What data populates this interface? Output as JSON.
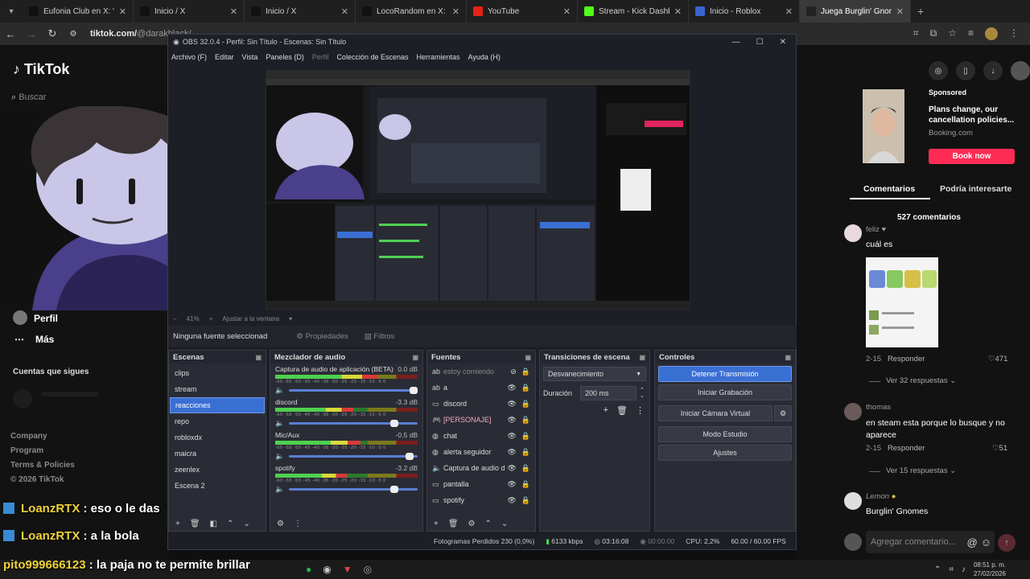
{
  "browser": {
    "tabs": [
      {
        "title": "Eufonia Club en X: \"MÁR",
        "icon": "x-icon",
        "color": "#111"
      },
      {
        "title": "Inicio / X",
        "icon": "x-icon",
        "color": "#111"
      },
      {
        "title": "Inicio / X",
        "icon": "x-icon",
        "color": "#111"
      },
      {
        "title": "LocoRandom en X: \"RESI",
        "icon": "x-icon",
        "color": "#111"
      },
      {
        "title": "YouTube",
        "icon": "youtube-icon",
        "color": "#e62117"
      },
      {
        "title": "Stream - Kick Dashboard",
        "icon": "kick-icon",
        "color": "#53fc18"
      },
      {
        "title": "Inicio - Roblox",
        "icon": "roblox-icon",
        "color": "#3b63d1"
      },
      {
        "title": "Juega Burglin' Gnomes: L",
        "icon": "tiktok-icon",
        "color": "#222"
      }
    ],
    "url_host": "tiktok.com/",
    "url_path": "@darakblack/..."
  },
  "tiktok": {
    "logo": "TikTok",
    "search": "Buscar",
    "profile": "Perfil",
    "more": "Más",
    "following": "Cuentas que sigues",
    "footer": [
      "Company",
      "Program",
      "Terms & Policies",
      "© 2026 TikTok"
    ],
    "sponsored": "Sponsored",
    "ad_title": "Plans change, our cancellation policies...",
    "ad_source": "Booking.com",
    "book_now": "Book now",
    "tab_comments": "Comentarios",
    "tab_interest": "Podría interesarte",
    "comments_count": "527 comentarios",
    "comments": [
      {
        "user": "feliz",
        "text": "cuál es",
        "date": "2-15",
        "reply": "Responder",
        "likes": "471",
        "replies": "Ver 32 respuestas"
      },
      {
        "user": "thomas",
        "text": "en steam esta porque lo busque y no aparece",
        "date": "2-15",
        "reply": "Responder",
        "likes": "51",
        "replies": "Ver 15 respuestas"
      },
      {
        "user": "Lemon",
        "text": "Burglin' Gnomes"
      }
    ],
    "add_comment": "Agregar comentario..."
  },
  "obs": {
    "title": "OBS 32.0.4 - Perfil: Sin Título - Escenas: Sin Título",
    "menu": [
      "Archivo (F)",
      "Editar",
      "Vista",
      "Paneles (D)",
      "Perfil",
      "Colección de Escenas",
      "Herramientas",
      "Ayuda (H)"
    ],
    "zoom": "41%",
    "fit": "Ajustar a la ventana",
    "no_source": "Ninguna fuente seleccionad",
    "properties": "Propiedades",
    "filters": "Filtros",
    "scenes_title": "Escenas",
    "scenes": [
      "clips",
      "stream",
      "reacciones",
      "repo",
      "robloxdx",
      "maicra",
      "zeenlex",
      "Escena 2"
    ],
    "mixer_title": "Mezclador de audio",
    "mixer": [
      {
        "name": "Captura de audio de aplicación (BETA)",
        "db": "0.0 dB",
        "level": 0.72,
        "vol": 1.0
      },
      {
        "name": "discord",
        "db": "-3.3 dB",
        "level": 0.55,
        "vol": 0.85
      },
      {
        "name": "Mic/Aux",
        "db": "-0.5 dB",
        "level": 0.6,
        "vol": 0.97
      },
      {
        "name": "spotify",
        "db": "-3.2 dB",
        "level": 0.5,
        "vol": 0.85
      }
    ],
    "scale": "-60 -55 -50 -45 -40 -35 -30 -25 -20 -15 -10 -5 0",
    "sources_title": "Fuentes",
    "sources": [
      {
        "name": "estoy comiendo",
        "icon": "text-icon",
        "dim": true
      },
      {
        "name": "a",
        "icon": "text-icon",
        "dim": false
      },
      {
        "name": "discord",
        "icon": "window-icon",
        "dim": false
      },
      {
        "name": "[PERSONAJE]",
        "icon": "game-icon",
        "dim": false
      },
      {
        "name": "chat",
        "icon": "globe-icon",
        "dim": false
      },
      {
        "name": "alerta seguidor",
        "icon": "globe-icon",
        "dim": false
      },
      {
        "name": "Captura de audio d",
        "icon": "speaker-icon",
        "dim": false
      },
      {
        "name": "pantalla",
        "icon": "monitor-icon",
        "dim": false
      },
      {
        "name": "spotify",
        "icon": "window-icon",
        "dim": false
      }
    ],
    "transitions_title": "Transiciones de escena",
    "transition": "Desvanecimiento",
    "duration_label": "Duración",
    "duration": "200 ms",
    "controls_title": "Controles",
    "controls": [
      "Detener Transmisión",
      "Iniciar Grabación",
      "Iniciar Cámara Virtual",
      "Modo Estudio",
      "Ajustes"
    ],
    "status": {
      "dropped": "Fotogramas Perdidos 230 (0,0%)",
      "kbps": "6133 kbps",
      "time": "03:16:08",
      "rec": "00:00:00",
      "cpu": "CPU: 2,2%",
      "fps": "60.00 / 60.00 FPS"
    }
  },
  "chat": [
    {
      "user": "LoanzRTX",
      "msg": ": eso o le das"
    },
    {
      "user": "LoanzRTX",
      "msg": ": a la bola"
    },
    {
      "user": "pito999666123",
      "msg": ": la paja no te permite brillar"
    }
  ],
  "taskbar": {
    "time": "08:51 p. m.",
    "date": "27/02/2026"
  }
}
